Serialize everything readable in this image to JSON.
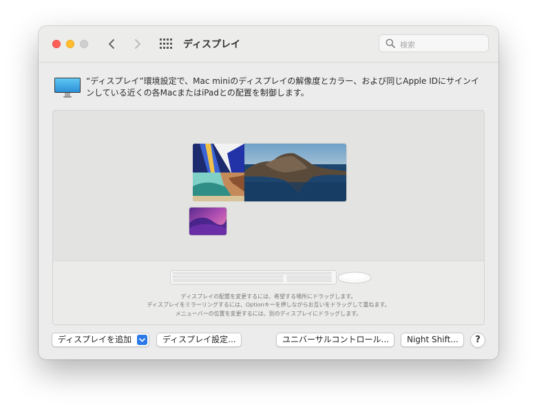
{
  "window": {
    "title": "ディスプレイ",
    "search_placeholder": "検索"
  },
  "description": "“ディスプレイ”環境設定で、Mac miniのディスプレイの解像度とカラー、および同じApple IDにサインインしている近くの各MacまたはiPadとの配置を制御します。",
  "arrangement": {
    "hints": [
      "ディスプレイの配置を変更するには、希望する場所にドラッグします。",
      "ディスプレイをミラーリングするには、Optionキーを押しながらお互いをドラッグして重ねます。",
      "メニューバーの位置を変更するには、別のディスプレイにドラッグします。"
    ]
  },
  "buttons": {
    "add_display": "ディスプレイを追加",
    "display_settings": "ディスプレイ設定...",
    "universal_control": "ユニバーサルコントロール...",
    "night_shift": "Night Shift...",
    "help": "?"
  },
  "colors": {
    "accent": "#2b79e8",
    "close": "#fe5f57",
    "minimize": "#febc2e",
    "zoom_disabled": "#cfcfcf"
  },
  "icons": [
    "close-icon",
    "minimize-icon",
    "zoom-icon",
    "chevron-left-icon",
    "chevron-right-icon",
    "grid-icon",
    "search-icon",
    "display-icon",
    "chevron-down-icon",
    "keyboard-icon",
    "mouse-icon"
  ]
}
